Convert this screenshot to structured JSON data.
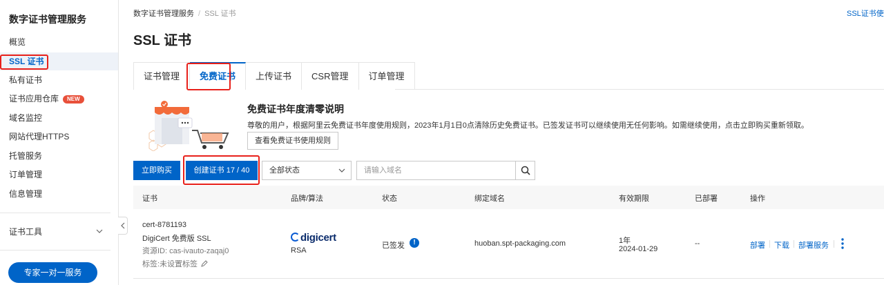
{
  "sidebar": {
    "title": "数字证书管理服务",
    "items": [
      {
        "label": "概览"
      },
      {
        "label": "SSL 证书",
        "active": true
      },
      {
        "label": "私有证书"
      },
      {
        "label": "证书应用仓库",
        "badge": "NEW"
      },
      {
        "label": "域名监控"
      },
      {
        "label": "网站代理HTTPS"
      },
      {
        "label": "托管服务"
      },
      {
        "label": "订单管理"
      },
      {
        "label": "信息管理"
      }
    ],
    "tools_label": "证书工具",
    "service_button": "专家一对一服务"
  },
  "breadcrumb": {
    "root": "数字证书管理服务",
    "separator": "/",
    "current": "SSL 证书"
  },
  "top_right_link": "SSL证书使用",
  "page_title": "SSL 证书",
  "tabs": [
    {
      "label": "证书管理"
    },
    {
      "label": "免费证书",
      "active": true
    },
    {
      "label": "上传证书"
    },
    {
      "label": "CSR管理"
    },
    {
      "label": "订单管理"
    }
  ],
  "banner": {
    "title": "免费证书年度清零说明",
    "description": "尊敬的用户，根据阿里云免费证书年度使用规则，2023年1月1日0点清除历史免费证书。已签发证书可以继续使用无任何影响。如需继续使用，点击立即购买重新领取。",
    "rules_button": "查看免费证书使用规则"
  },
  "toolbar": {
    "buy_button": "立即购买",
    "create_button": "创建证书 17 / 40",
    "status_select": "全部状态",
    "search_placeholder": "请输入域名"
  },
  "table": {
    "headers": [
      "证书",
      "品牌/算法",
      "状态",
      "绑定域名",
      "有效期限",
      "已部署",
      "操作"
    ],
    "rows": [
      {
        "cert_name": "cert-8781193",
        "cert_type": "DigiCert 免费版 SSL",
        "resource_id": "资源ID: cas-ivauto-zaqaj0",
        "tag": "标签:未设置标签",
        "brand": "digicert",
        "algorithm": "RSA",
        "status": "已签发",
        "domain": "huoban.spt-packaging.com",
        "validity_period": "1年",
        "validity_date": "2024-01-29",
        "deployed": "--",
        "actions": [
          "部署",
          "下载",
          "部署服务"
        ]
      }
    ]
  },
  "colors": {
    "accent": "#0064c8",
    "highlight": "#e8201a",
    "badge": "#e8503a"
  }
}
